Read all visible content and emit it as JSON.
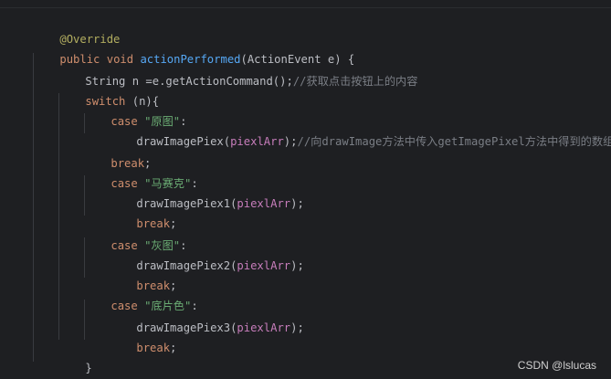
{
  "editor": {
    "lines": [
      {
        "annotation": "@Override"
      },
      {
        "kw1": "public",
        "kw2": "void",
        "method": "actionPerformed",
        "params": "(ActionEvent e) {"
      },
      {
        "text": "String n =e.getActionCommand();",
        "comment": "//获取点击按钮上的内容"
      },
      {
        "kw": "switch",
        "text": " (n){"
      },
      {
        "kw": "case",
        "str": "\"原图\"",
        "text": ":"
      },
      {
        "call": "drawImagePiex(",
        "arg": "piexlArr",
        "end": ");",
        "comment": "//向drawImage方法中传入getImagePixel方法中得到的数组"
      },
      {
        "kw": "break",
        "text": ";"
      },
      {
        "kw": "case",
        "str": "\"马赛克\"",
        "text": ":"
      },
      {
        "call": "drawImagePiex1(",
        "arg": "piexlArr",
        "end": ");"
      },
      {
        "kw": "break",
        "text": ";"
      },
      {
        "kw": "case",
        "str": "\"灰图\"",
        "text": ":"
      },
      {
        "call": "drawImagePiex2(",
        "arg": "piexlArr",
        "end": ");"
      },
      {
        "kw": "break",
        "text": ";"
      },
      {
        "kw": "case",
        "str": "\"底片色\"",
        "text": ":"
      },
      {
        "call": "drawImagePiex3(",
        "arg": "piexlArr",
        "end": ");"
      },
      {
        "kw": "break",
        "text": ";"
      },
      {
        "text": "}"
      },
      {
        "text": "}"
      }
    ]
  },
  "watermark": "CSDN @lslucas",
  "colors": {
    "background": "#1e1f22",
    "keyword": "#cf8e6d",
    "string": "#6aab73",
    "comment": "#7a7e85",
    "method": "#56a8f5",
    "annotation": "#b3ae60",
    "field": "#c77dbb",
    "text": "#bcbec4"
  }
}
